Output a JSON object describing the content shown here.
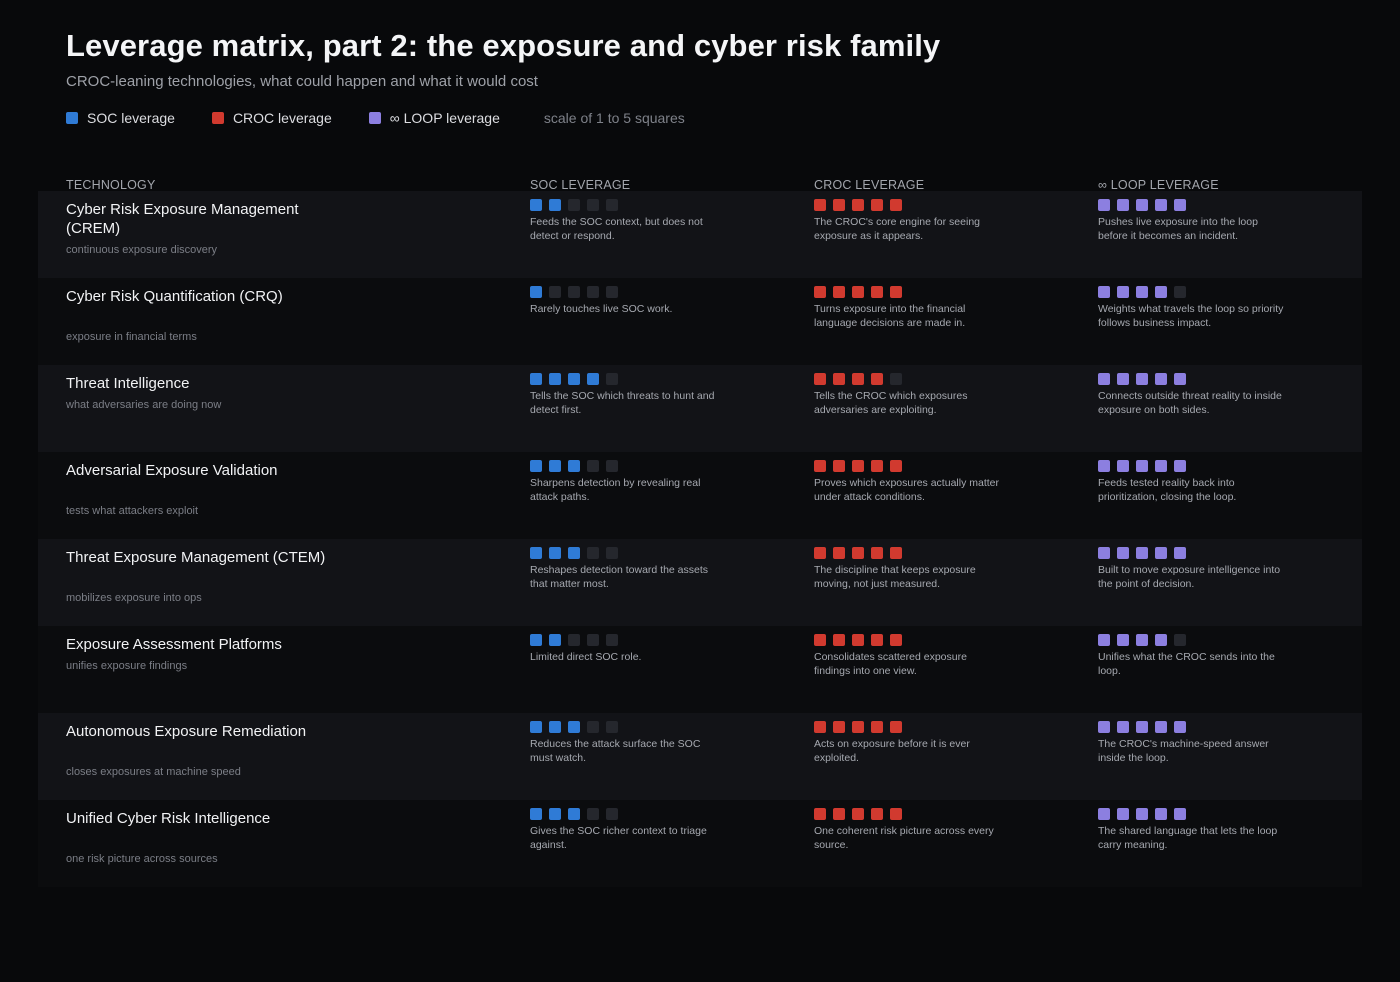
{
  "title": "Leverage matrix, part 2: the exposure and cyber risk family",
  "subtitle": "CROC-leaning technologies, what could happen and what it would cost",
  "legend": {
    "soc": "SOC leverage",
    "croc": "CROC leverage",
    "loop": "∞ LOOP leverage",
    "note": "scale of 1 to 5 squares"
  },
  "colors": {
    "soc": "#2f7bd6",
    "croc": "#d13a2f",
    "loop": "#8c7fe0",
    "empty": "#25272d"
  },
  "columns": {
    "technology": "TECHNOLOGY",
    "soc": "SOC LEVERAGE",
    "croc": "CROC LEVERAGE",
    "loop": "∞ LOOP LEVERAGE"
  },
  "chart_data": {
    "type": "table",
    "scale_max": 5,
    "series": [
      {
        "name": "SOC leverage",
        "values": [
          2,
          1,
          4,
          3,
          3,
          2,
          3,
          3
        ]
      },
      {
        "name": "CROC leverage",
        "values": [
          5,
          5,
          4,
          5,
          5,
          5,
          5,
          5
        ]
      },
      {
        "name": "∞ LOOP leverage",
        "values": [
          5,
          4,
          5,
          5,
          5,
          4,
          5,
          5
        ]
      }
    ],
    "rows": [
      {
        "name": "Cyber Risk Exposure Management (CREM)",
        "sub": "continuous exposure discovery",
        "soc": 2,
        "croc": 5,
        "loop": 5,
        "soc_note": "Feeds the SOC context, but does not detect or respond.",
        "croc_note": "The CROC's core engine for seeing exposure as it appears.",
        "loop_note": "Pushes live exposure into the loop before it becomes an incident."
      },
      {
        "name": "Cyber Risk Quantification (CRQ)",
        "sub": "exposure in financial terms",
        "soc": 1,
        "croc": 5,
        "loop": 4,
        "soc_note": "Rarely touches live SOC work.",
        "croc_note": "Turns exposure into the financial language decisions are made in.",
        "loop_note": "Weights what travels the loop so priority follows business impact."
      },
      {
        "name": "Threat Intelligence",
        "sub": "what adversaries are doing now",
        "soc": 4,
        "croc": 4,
        "loop": 5,
        "soc_note": "Tells the SOC which threats to hunt and detect first.",
        "croc_note": "Tells the CROC which exposures adversaries are exploiting.",
        "loop_note": "Connects outside threat reality to inside exposure on both sides."
      },
      {
        "name": "Adversarial Exposure Validation",
        "sub": "tests what attackers exploit",
        "soc": 3,
        "croc": 5,
        "loop": 5,
        "soc_note": "Sharpens detection by revealing real attack paths.",
        "croc_note": "Proves which exposures actually matter under attack conditions.",
        "loop_note": "Feeds tested reality back into prioritization, closing the loop."
      },
      {
        "name": "Threat Exposure Management (CTEM)",
        "sub": "mobilizes exposure into ops",
        "soc": 3,
        "croc": 5,
        "loop": 5,
        "soc_note": "Reshapes detection toward the assets that matter most.",
        "croc_note": "The discipline that keeps exposure moving, not just measured.",
        "loop_note": "Built to move exposure intelligence into the point of decision."
      },
      {
        "name": "Exposure Assessment Platforms",
        "sub": "unifies exposure findings",
        "soc": 2,
        "croc": 5,
        "loop": 4,
        "soc_note": "Limited direct SOC role.",
        "croc_note": "Consolidates scattered exposure findings into one view.",
        "loop_note": "Unifies what the CROC sends into the loop."
      },
      {
        "name": "Autonomous Exposure Remediation",
        "sub": "closes exposures at machine speed",
        "soc": 3,
        "croc": 5,
        "loop": 5,
        "soc_note": "Reduces the attack surface the SOC must watch.",
        "croc_note": "Acts on exposure before it is ever exploited.",
        "loop_note": "The CROC's machine-speed answer inside the loop."
      },
      {
        "name": "Unified Cyber Risk Intelligence",
        "sub": "one risk picture across sources",
        "soc": 3,
        "croc": 5,
        "loop": 5,
        "soc_note": "Gives the SOC richer context to triage against.",
        "croc_note": "One coherent risk picture across every source.",
        "loop_note": "The shared language that lets the loop carry meaning."
      }
    ]
  }
}
